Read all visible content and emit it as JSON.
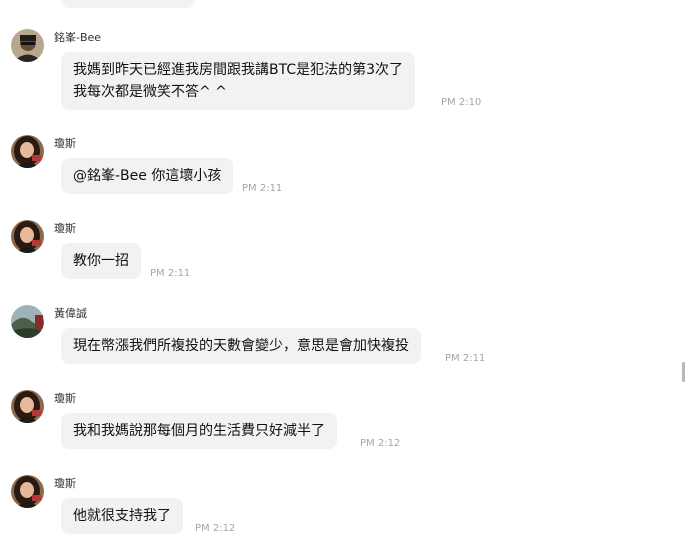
{
  "messages": [
    {
      "sender": "銘峯-Bee",
      "avatar": "male-avatar-icon",
      "lines": [
        "我媽到昨天已經進我房間跟我講BTC是犯法的第3次了",
        "我每次都是微笑不答^ ^"
      ],
      "time": "PM 2:10"
    },
    {
      "sender": "瓊斯",
      "avatar": "female-avatar-icon",
      "lines": [
        "@銘峯-Bee 你這壞小孩"
      ],
      "time": "PM 2:11"
    },
    {
      "sender": "瓊斯",
      "avatar": "female-avatar-icon",
      "lines": [
        "教你一招"
      ],
      "time": "PM 2:11"
    },
    {
      "sender": "黃偉誠",
      "avatar": "landscape-avatar-icon",
      "lines": [
        "現在幣漲我們所複投的天數會變少，意思是會加快複投"
      ],
      "time": "PM 2:11"
    },
    {
      "sender": "瓊斯",
      "avatar": "female-avatar-icon",
      "lines": [
        "我和我媽說那每個月的生活費只好減半了"
      ],
      "time": "PM 2:12"
    },
    {
      "sender": "瓊斯",
      "avatar": "female-avatar-icon",
      "lines": [
        "他就很支持我了"
      ],
      "time": "PM 2:12"
    }
  ]
}
